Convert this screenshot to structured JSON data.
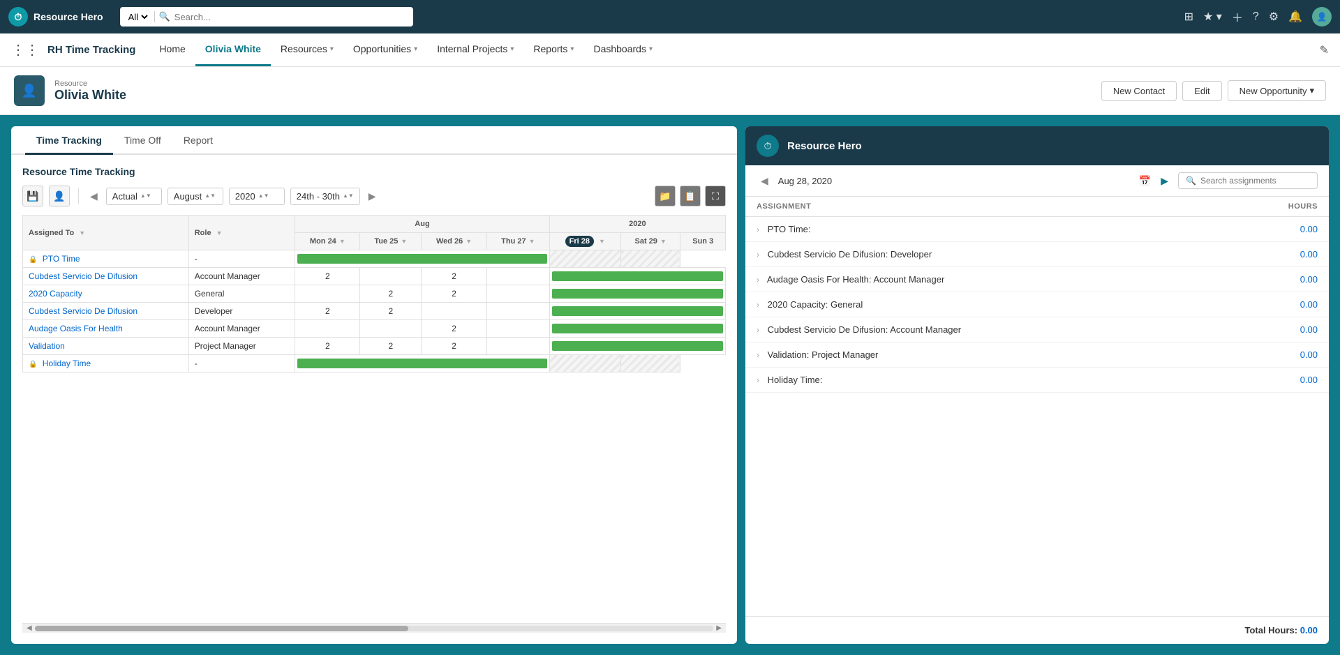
{
  "topbar": {
    "logo_text": "Resource Hero",
    "search_placeholder": "Search...",
    "search_all_label": "All",
    "icons": [
      "grid-icon",
      "star-icon",
      "plus-icon",
      "question-icon",
      "gear-icon",
      "bell-icon",
      "avatar-icon"
    ]
  },
  "appbar": {
    "title": "RH Time Tracking",
    "nav_items": [
      {
        "label": "Home",
        "active": false,
        "has_dropdown": false
      },
      {
        "label": "Olivia White",
        "active": true,
        "has_dropdown": false
      },
      {
        "label": "Resources",
        "active": false,
        "has_dropdown": true
      },
      {
        "label": "Opportunities",
        "active": false,
        "has_dropdown": true
      },
      {
        "label": "Internal Projects",
        "active": false,
        "has_dropdown": true
      },
      {
        "label": "Reports",
        "active": false,
        "has_dropdown": true
      },
      {
        "label": "Dashboards",
        "active": false,
        "has_dropdown": true
      }
    ]
  },
  "page_header": {
    "subtitle": "Resource",
    "title": "Olivia White",
    "btn_new_contact": "New Contact",
    "btn_edit": "Edit",
    "btn_new_opportunity": "New Opportunity"
  },
  "tabs": [
    {
      "label": "Time Tracking",
      "active": true
    },
    {
      "label": "Time Off",
      "active": false
    },
    {
      "label": "Report",
      "active": false
    }
  ],
  "time_tracking": {
    "panel_title": "Resource Time Tracking",
    "view_mode": "Actual",
    "month": "August",
    "year": "2020",
    "date_range": "24th - 30th",
    "table": {
      "col_assigned_to": "Assigned To",
      "col_role": "Role",
      "date_label_week": "Aug",
      "date_label_year": "2020",
      "columns": [
        {
          "label": "Mon 24",
          "highlight": false
        },
        {
          "label": "Tue 25",
          "highlight": false
        },
        {
          "label": "Wed 26",
          "highlight": false
        },
        {
          "label": "Thu 27",
          "highlight": false
        },
        {
          "label": "Fri 28",
          "highlight": true
        },
        {
          "label": "Sat 29",
          "highlight": false
        },
        {
          "label": "Sun 3",
          "highlight": false
        }
      ],
      "rows": [
        {
          "name": "PTO Time",
          "role": "-",
          "locked": true,
          "is_link": false,
          "cells": [
            "",
            "",
            "",
            "",
            "",
            "",
            ""
          ],
          "has_bar": true,
          "bar_cols": [
            0,
            1,
            2,
            3
          ],
          "hatched_cols": [
            4,
            5,
            6
          ]
        },
        {
          "name": "Cubdest Servicio De Difusion",
          "role": "Account Manager",
          "locked": false,
          "is_link": true,
          "cells": [
            "2",
            "",
            "2",
            "",
            "",
            "",
            ""
          ],
          "has_bar": true,
          "bar_cols": [
            0,
            1,
            2,
            3
          ],
          "hatched_cols": [
            4,
            5,
            6
          ]
        },
        {
          "name": "2020 Capacity",
          "role": "General",
          "locked": false,
          "is_link": true,
          "cells": [
            "",
            "2",
            "2",
            "",
            "",
            "",
            ""
          ],
          "has_bar": true,
          "bar_cols": [
            0,
            1,
            2,
            3
          ],
          "hatched_cols": [
            4,
            5,
            6
          ]
        },
        {
          "name": "Cubdest Servicio De Difusion",
          "role": "Developer",
          "locked": false,
          "is_link": true,
          "cells": [
            "2",
            "2",
            "",
            "",
            "",
            "",
            ""
          ],
          "has_bar": true,
          "bar_cols": [
            0,
            1,
            2,
            3
          ],
          "hatched_cols": [
            4,
            5,
            6
          ]
        },
        {
          "name": "Audage Oasis For Health",
          "role": "Account Manager",
          "locked": false,
          "is_link": true,
          "cells": [
            "",
            "",
            "2",
            "",
            "",
            "",
            ""
          ],
          "has_bar": true,
          "bar_cols": [
            0,
            1,
            2,
            3
          ],
          "hatched_cols": [
            4,
            5,
            6
          ]
        },
        {
          "name": "Validation",
          "role": "Project Manager",
          "locked": false,
          "is_link": true,
          "cells": [
            "2",
            "2",
            "2",
            "",
            "",
            "",
            ""
          ],
          "has_bar": true,
          "bar_cols": [
            0,
            1,
            2,
            3
          ],
          "hatched_cols": [
            4,
            5,
            6
          ]
        },
        {
          "name": "Holiday Time",
          "role": "-",
          "locked": true,
          "is_link": false,
          "cells": [
            "",
            "",
            "",
            "",
            "",
            "",
            ""
          ],
          "has_bar": true,
          "bar_cols": [
            0,
            1,
            2,
            3
          ],
          "hatched_cols": [
            4,
            5,
            6
          ]
        }
      ]
    }
  },
  "right_panel": {
    "title": "Resource Hero",
    "date": "Aug 28, 2020",
    "search_placeholder": "Search assignments",
    "col_assignment": "ASSIGNMENT",
    "col_hours": "HOURS",
    "assignments": [
      {
        "name": "PTO Time:",
        "hours": "0.00"
      },
      {
        "name": "Cubdest Servicio De Difusion: Developer",
        "hours": "0.00"
      },
      {
        "name": "Audage Oasis For Health: Account Manager",
        "hours": "0.00"
      },
      {
        "name": "2020 Capacity: General",
        "hours": "0.00"
      },
      {
        "name": "Cubdest Servicio De Difusion: Account Manager",
        "hours": "0.00"
      },
      {
        "name": "Validation: Project Manager",
        "hours": "0.00"
      },
      {
        "name": "Holiday Time:",
        "hours": "0.00"
      }
    ],
    "total_label": "Total Hours:",
    "total_hours": "0.00"
  }
}
